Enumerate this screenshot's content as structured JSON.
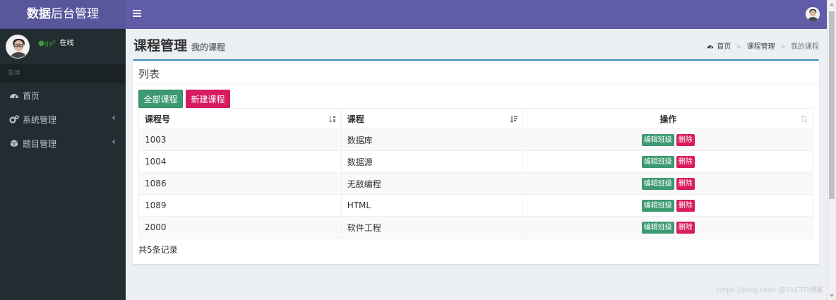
{
  "app": {
    "logo_bold": "数据",
    "logo_rest": "后台管理"
  },
  "user": {
    "status_dot": "●",
    "name": "gyf",
    "status": "在线"
  },
  "sidebar": {
    "header": "菜单",
    "items": [
      {
        "label": "首页",
        "icon": "dashboard-icon",
        "arrow": ""
      },
      {
        "label": "系统管理",
        "icon": "gears-icon",
        "arrow": "‹"
      },
      {
        "label": "题目管理",
        "icon": "cube-icon",
        "arrow": "‹"
      }
    ]
  },
  "page": {
    "title": "课程管理",
    "subtitle": "我的课程"
  },
  "breadcrumb": {
    "home": "首页",
    "section": "课程管理",
    "current": "我的课程",
    "separator": ">"
  },
  "box": {
    "title": "列表",
    "buttons": {
      "all_courses": "全部课程",
      "new_course": "新建课程"
    }
  },
  "table": {
    "columns": [
      "课程号",
      "课程",
      "操作"
    ],
    "rows": [
      {
        "id": "1003",
        "name": "数据库"
      },
      {
        "id": "1004",
        "name": "数据源"
      },
      {
        "id": "1086",
        "name": "无敌编程"
      },
      {
        "id": "1089",
        "name": "HTML"
      },
      {
        "id": "2000",
        "name": "软件工程"
      }
    ],
    "actions": {
      "edit_class": "编辑班级",
      "delete": "删除"
    }
  },
  "footer": {
    "record_count": "共5条记录"
  },
  "watermark": "https://blog.csdn.@51CTO博客",
  "colors": {
    "topbar": "#605ca8",
    "logo_bg": "#59579c",
    "sidebar": "#222d32",
    "success": "#3d9970",
    "danger": "#d81b60",
    "box_border": "#3c8dbc"
  }
}
